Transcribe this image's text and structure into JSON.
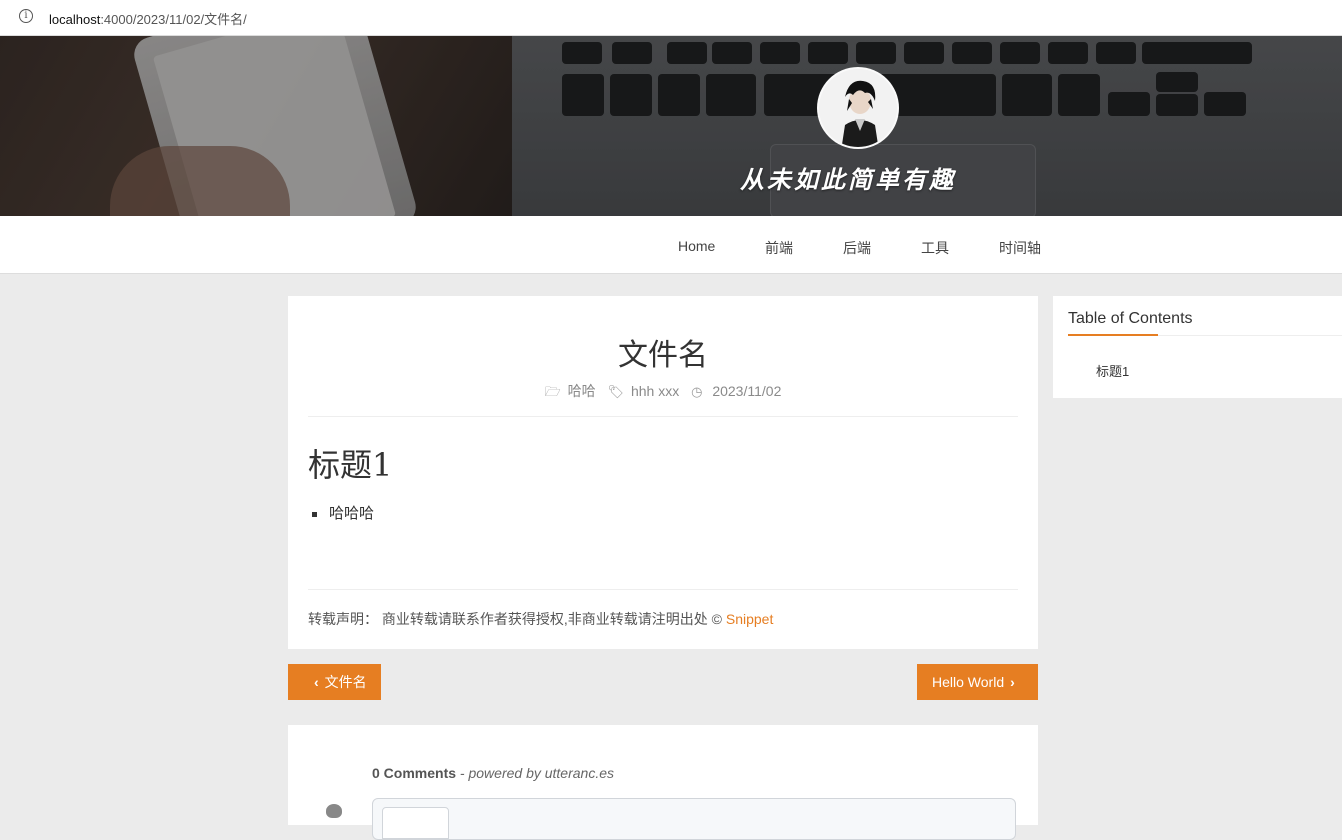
{
  "browser": {
    "url_host": "localhost",
    "url_path": ":4000/2023/11/02/文件名/"
  },
  "header": {
    "slogan": "从未如此简单有趣"
  },
  "nav": {
    "items": [
      "Home",
      "前端",
      "后端",
      "工具",
      "时间轴"
    ]
  },
  "post": {
    "title": "文件名",
    "category": "哈哈",
    "tags": [
      "hhh",
      "xxx"
    ],
    "date": "2023/11/02",
    "heading": "标题1",
    "list": [
      "哈哈哈"
    ],
    "copyright_label": "转载声明：",
    "copyright_text": "商业转载请联系作者获得授权,非商业转载请注明出处 ©",
    "copyright_link": "Snippet"
  },
  "pager": {
    "prev_label": "文件名",
    "next_label": "Hello World"
  },
  "comments": {
    "count_label": "0 Comments",
    "powered_by": "- powered by utteranc.es"
  },
  "toc": {
    "title": "Table of Contents",
    "items": [
      "标题1"
    ]
  },
  "colors": {
    "accent": "#e67e22",
    "page_bg": "#ebebeb"
  }
}
